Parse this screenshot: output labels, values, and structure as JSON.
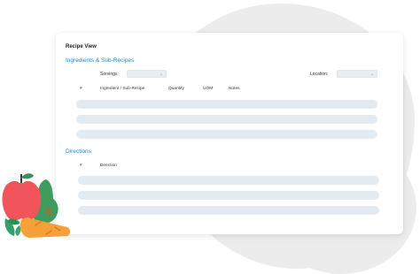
{
  "page": {
    "title": "Recipe View",
    "ingredients": {
      "heading": "Ingredients & Sub-Recipes",
      "servings_label": "Servings:",
      "servings_value": "",
      "location_label": "Location:",
      "location_value": "",
      "columns": [
        "#",
        "Ingredient / Sub-Recipe",
        "Quantity",
        "UOM",
        "Notes"
      ],
      "rows": [
        {},
        {},
        {}
      ]
    },
    "directions": {
      "heading": "Directions",
      "columns": [
        "#",
        "Direction"
      ],
      "rows": [
        {},
        {},
        {}
      ]
    }
  },
  "colors": {
    "accent": "#1e88d9",
    "placeholder_bar": "#e3eaf0",
    "background_blob": "#ececed"
  },
  "illustration": {
    "icons": [
      "apple-icon",
      "pear-icon",
      "carrot-icon",
      "leaf-icon"
    ]
  }
}
